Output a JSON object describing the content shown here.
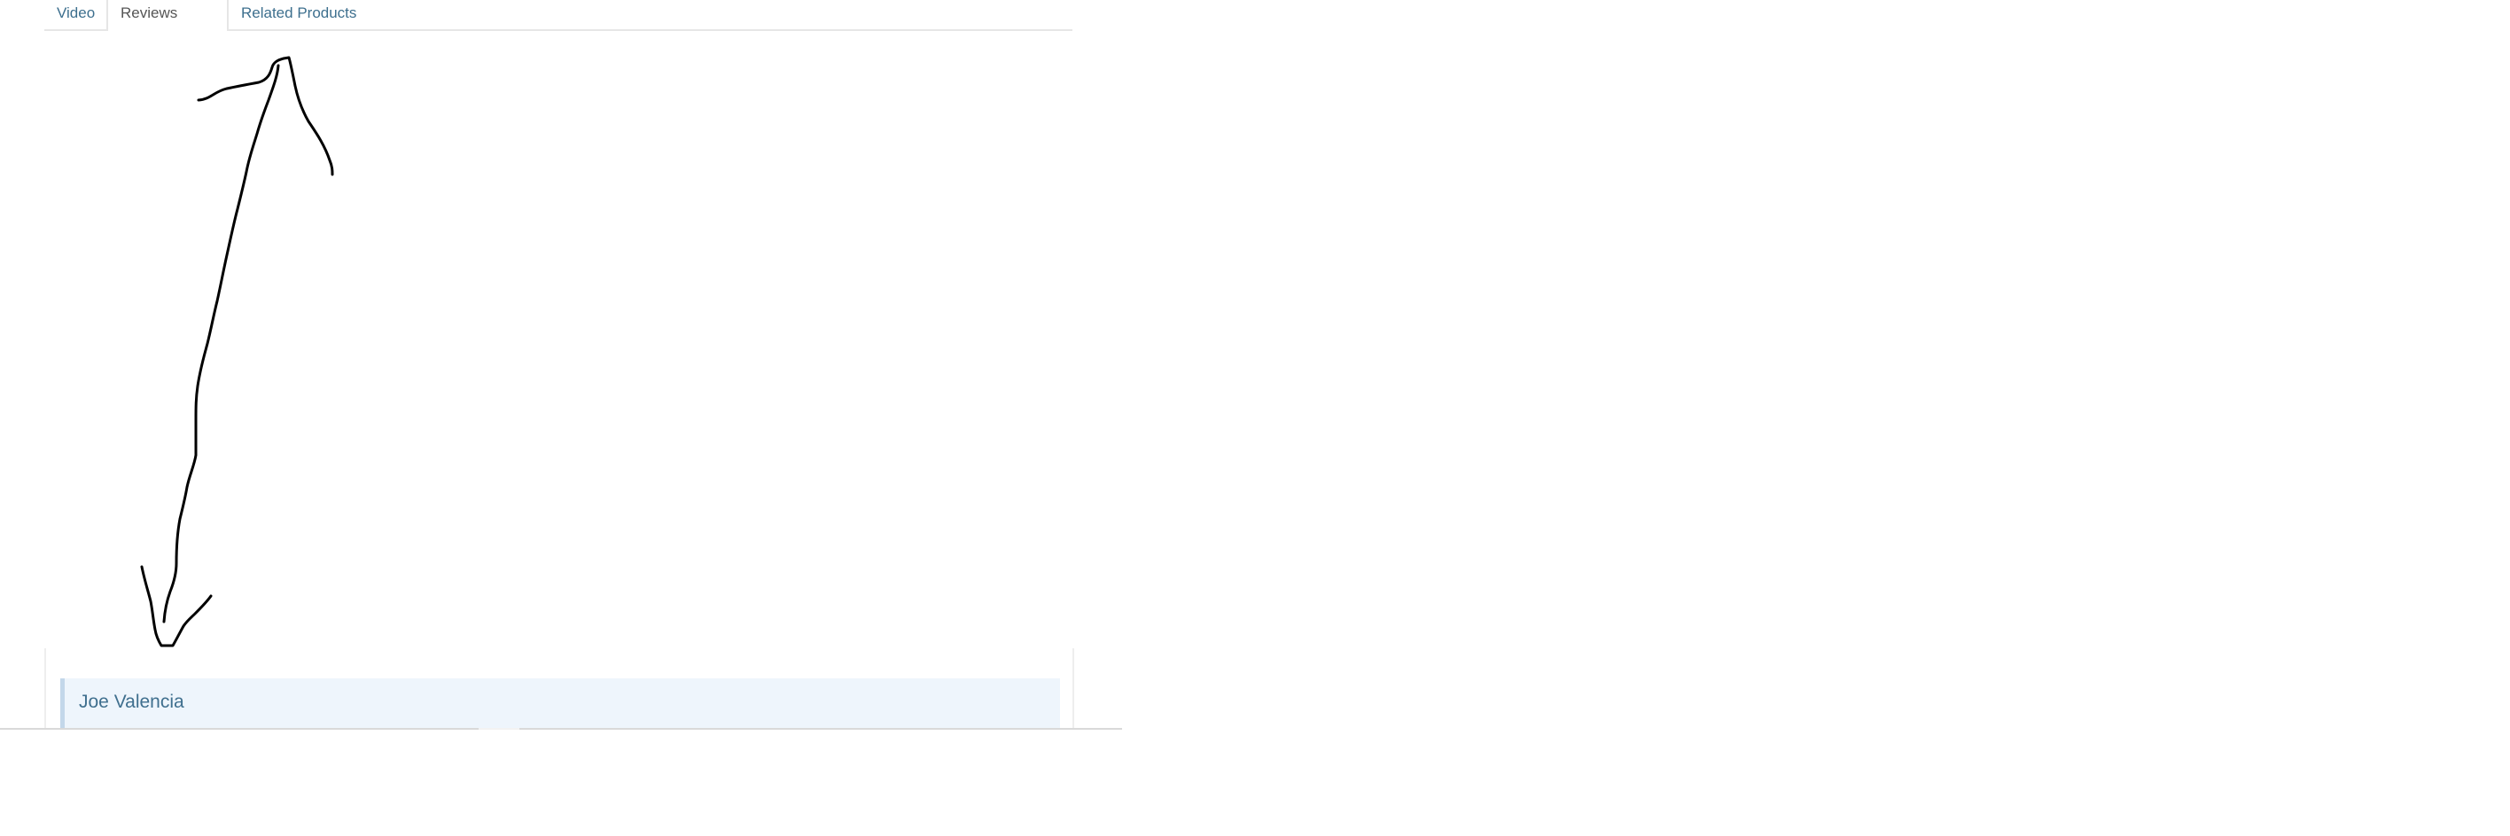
{
  "tabs": [
    {
      "label": "Video",
      "active": false
    },
    {
      "label": "Reviews",
      "active": true
    },
    {
      "label": "Related Products",
      "active": false
    }
  ],
  "review": {
    "author": "Joe Valencia"
  },
  "colors": {
    "link": "#3d6f8e",
    "active_tab_text": "#555555",
    "review_header_bg": "#eef5fc",
    "review_header_border": "#c3d7ea",
    "sketch_stroke": "#000000"
  },
  "annotation": {
    "shape": "hand-drawn double-headed arrow"
  }
}
